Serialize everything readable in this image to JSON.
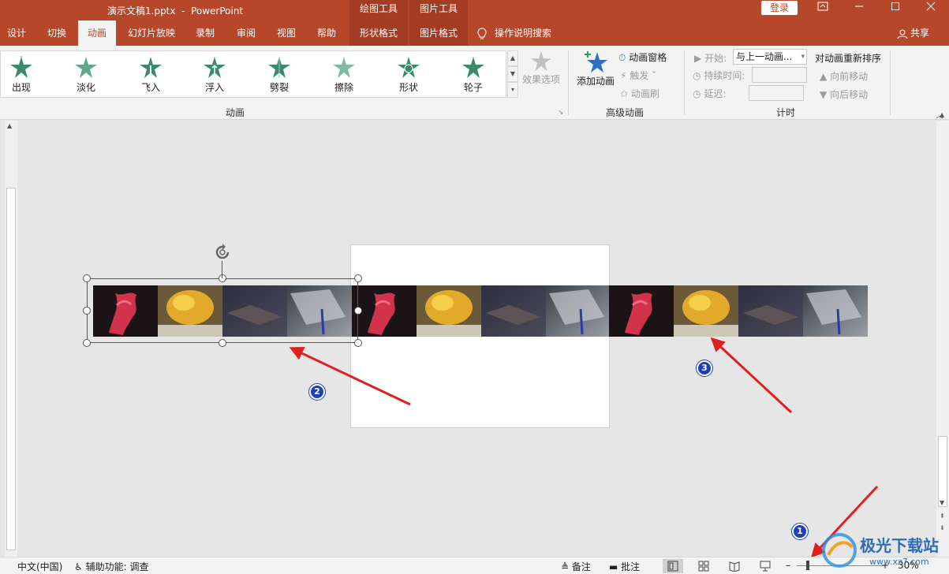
{
  "titlebar": {
    "title": "演示文稿1.pptx  -  PowerPoint",
    "context_drawing": "绘图工具",
    "context_picture": "图片工具",
    "login": "登录"
  },
  "tabs": [
    {
      "label": "设计"
    },
    {
      "label": "切换"
    },
    {
      "label": "动画"
    },
    {
      "label": "幻灯片放映"
    },
    {
      "label": "录制"
    },
    {
      "label": "审阅"
    },
    {
      "label": "视图"
    },
    {
      "label": "帮助"
    },
    {
      "label": "形状格式"
    },
    {
      "label": "图片格式"
    }
  ],
  "search_label": "操作说明搜索",
  "share_label": "共享",
  "ribbon": {
    "animations": [
      {
        "label": "出现"
      },
      {
        "label": "淡化"
      },
      {
        "label": "飞入"
      },
      {
        "label": "浮入"
      },
      {
        "label": "劈裂"
      },
      {
        "label": "擦除"
      },
      {
        "label": "形状"
      },
      {
        "label": "轮子"
      }
    ],
    "effect_options": "效果选项",
    "group_animation": "动画",
    "add_animation": "添加动画",
    "animation_pane": "动画窗格",
    "trigger": "触发",
    "animation_painter": "动画刷",
    "group_advanced": "高级动画",
    "start_label": "开始:",
    "start_value": "与上一动画...",
    "duration_label": "持续时间:",
    "delay_label": "延迟:",
    "group_timing": "计时",
    "reorder_title": "对动画重新排序",
    "move_earlier": "向前移动",
    "move_later": "向后移动"
  },
  "annotations": {
    "badge1": "1",
    "badge2": "2",
    "badge3": "3"
  },
  "statusbar": {
    "language": "中文(中国)",
    "accessibility": "辅助功能: 调查",
    "notes": "备注",
    "comments": "批注",
    "zoom": "30%"
  },
  "watermark": {
    "brand": "极光下载站",
    "url": "www.xz7.com"
  },
  "colors": {
    "accent": "#b7472a",
    "badge": "#1e3fb8",
    "arrow": "#e02020"
  }
}
